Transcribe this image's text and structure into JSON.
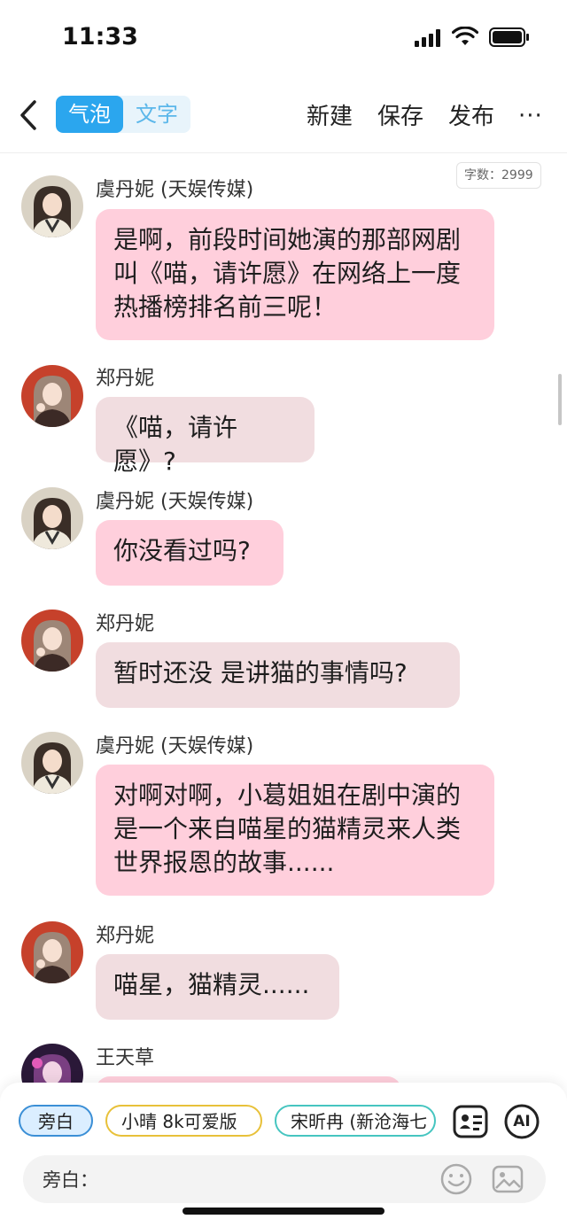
{
  "status": {
    "time": "11:33"
  },
  "nav": {
    "seg_bubble": "气泡",
    "seg_text": "文字",
    "new_label": "新建",
    "save_label": "保存",
    "publish_label": "发布",
    "more": "···"
  },
  "word_count": "字数：2999",
  "messages": [
    {
      "name": "虞丹妮 (天娱传媒)",
      "text": "是啊，前段时间她演的那部网剧叫《喵，请许愿》在网络上一度热播榜排名前三呢！"
    },
    {
      "name": "郑丹妮",
      "text": "《喵，请许愿》?"
    },
    {
      "name": "虞丹妮 (天娱传媒)",
      "text": "你没看过吗?"
    },
    {
      "name": "郑丹妮",
      "text": "暂时还没 是讲猫的事情吗?"
    },
    {
      "name": "虞丹妮 (天娱传媒)",
      "text": "对啊对啊，小葛姐姐在剧中演的是一个来自喵星的猫精灵来人类世界报恩的故事......"
    },
    {
      "name": "郑丹妮",
      "text": "喵星，猫精灵......"
    },
    {
      "name": "王天草",
      "text": ""
    }
  ],
  "bottom": {
    "chips": [
      "旁白",
      "小晴 8k可爱版",
      "宋昕冉 (新沧海七"
    ],
    "ai_label": "AI",
    "input_label": "旁白：",
    "input_placeholder": ""
  },
  "colors": {
    "accent": "#2ba6ee",
    "bubble_pink": "#ffcfdc",
    "bubble_mauve": "#f1dde0"
  }
}
